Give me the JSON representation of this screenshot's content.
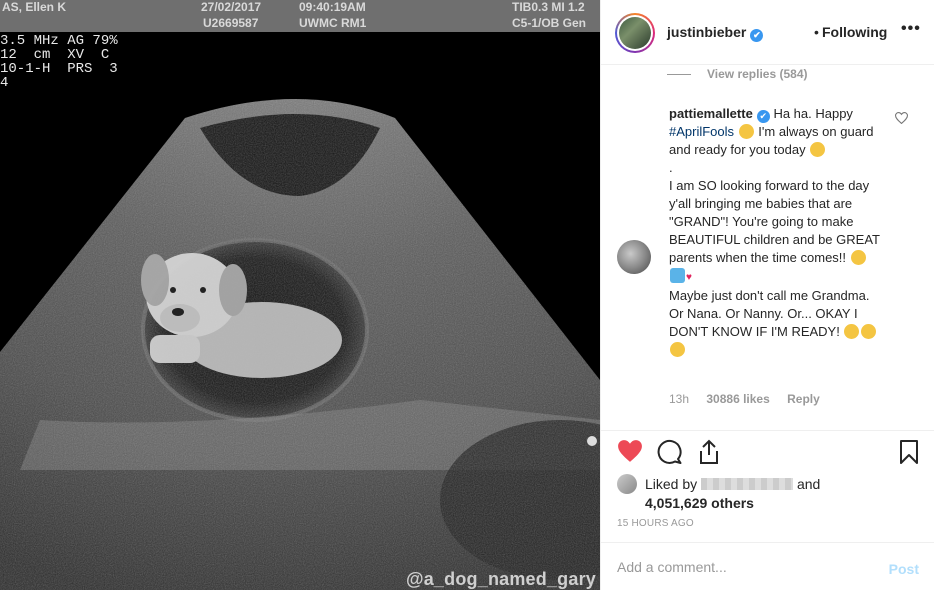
{
  "media": {
    "top_bar": {
      "patient": "AS, Ellen K",
      "date": "27/02/2017",
      "id": "U2669587",
      "time": "09:40:19AM",
      "room": "UWMC RM1",
      "tib": "TIB0.3 MI 1.2",
      "probe": "C5-1/OB Gen"
    },
    "params": "3.5 MHz AG 79%\n12  cm  XV  C\n10-1-H  PRS  3\n4",
    "watermark": "@a_dog_named_gary"
  },
  "header": {
    "username": "justinbieber",
    "verified_icon": "✔",
    "dot": "•",
    "follow_status": "Following",
    "more_icon": "•••"
  },
  "view_replies": "View replies (584)",
  "comment": {
    "username": "pattiemallette",
    "verified_icon": "✔",
    "text_1": "Ha ha. Happy",
    "hashtag": "#AprilFools",
    "text_2": "I'm always on guard and ready for you today",
    "text_3": ".",
    "text_4": "I am SO looking forward to the day y'all bringing me babies that are \"GRAND\"! You're going to make BEAUTIFUL children and be GREAT parents when the time comes!!",
    "text_5": "Maybe just don't call me Grandma. Or Nana. Or Nanny. Or... OKAY I DON'T KNOW IF I'M READY!",
    "time_ago": "13h",
    "likes": "30886 likes",
    "reply": "Reply"
  },
  "liked_by": {
    "prefix": "Liked by",
    "and": "and",
    "others": "4,051,629 others"
  },
  "timestamp": "15 HOURS AGO",
  "comment_box": {
    "placeholder": "Add a comment...",
    "post": "Post"
  },
  "colors": {
    "heart": "#ed4956",
    "link_blue": "#3897f0",
    "hashtag": "#003569",
    "muted": "#999999"
  }
}
